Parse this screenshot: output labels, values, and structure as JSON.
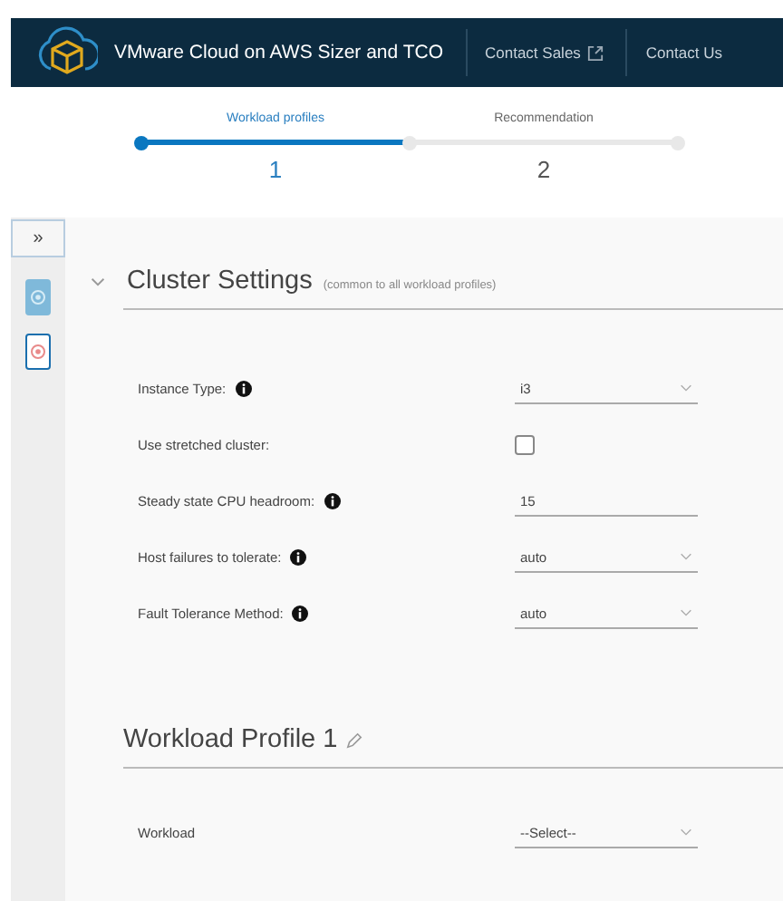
{
  "header": {
    "title": "VMware Cloud on AWS Sizer and TCO",
    "links": [
      {
        "label": "Contact Sales",
        "external": true
      },
      {
        "label": "Contact Us",
        "external": false
      }
    ]
  },
  "stepper": [
    {
      "label": "Workload profiles",
      "number": "1",
      "selected": true
    },
    {
      "label": "Recommendation",
      "number": "2",
      "selected": false
    }
  ],
  "sidebar": {
    "toggle": "»",
    "items": [
      {
        "selected": true,
        "kind": "gear"
      },
      {
        "selected": false,
        "kind": "target"
      }
    ]
  },
  "cluster_settings": {
    "title": "Cluster Settings",
    "subtitle": "(common to all workload profiles)",
    "expanded": true,
    "fields": [
      {
        "label": "Instance Type:",
        "info": true,
        "kind": "select",
        "value": "i3"
      },
      {
        "label": "Use stretched cluster:",
        "info": false,
        "kind": "checkbox",
        "checked": false
      },
      {
        "label": "Steady state CPU headroom:",
        "info": true,
        "kind": "text",
        "value": "15"
      },
      {
        "label": "Host failures to tolerate:",
        "info": true,
        "kind": "select",
        "value": "auto"
      },
      {
        "label": "Fault Tolerance Method:",
        "info": true,
        "kind": "select",
        "value": "auto"
      }
    ]
  },
  "workload_profile": {
    "title": "Workload Profile 1",
    "editable": true,
    "fields": [
      {
        "label": "Workload",
        "info": false,
        "kind": "select",
        "value": "--Select--"
      }
    ]
  }
}
